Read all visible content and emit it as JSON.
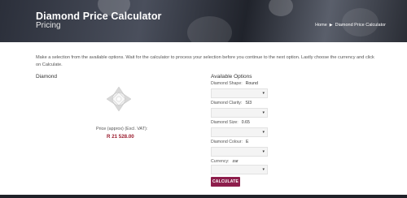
{
  "header": {
    "title": "Diamond Price Calculator",
    "subtitle": "Pricing",
    "breadcrumb": {
      "home": "Home",
      "current": "Diamond Price Calculator"
    }
  },
  "intro_text": "Make a selection from the available options. Wait for the calculator to process your selection before you continue to the next option. Lastly choose the currency and click on Calculate.",
  "left": {
    "heading": "Diamond",
    "price_label": "Price (approx) (Excl. VAT):",
    "price_value": "R 21 528.00"
  },
  "options": {
    "heading": "Available Options",
    "shape": {
      "label": "Diamond Shape:",
      "value": "Round"
    },
    "clarity": {
      "label": "Diamond Clarity:",
      "value": "SI3"
    },
    "size": {
      "label": "Diamond Size:",
      "value": "0.65"
    },
    "colour": {
      "label": "Diamond Colour:",
      "value": "E"
    },
    "currency": {
      "label": "Currency:",
      "value": "zar"
    }
  },
  "calculate_label": "CALCULATE",
  "colors": {
    "accent": "#8d1d4b",
    "price": "#9b1c2e"
  }
}
